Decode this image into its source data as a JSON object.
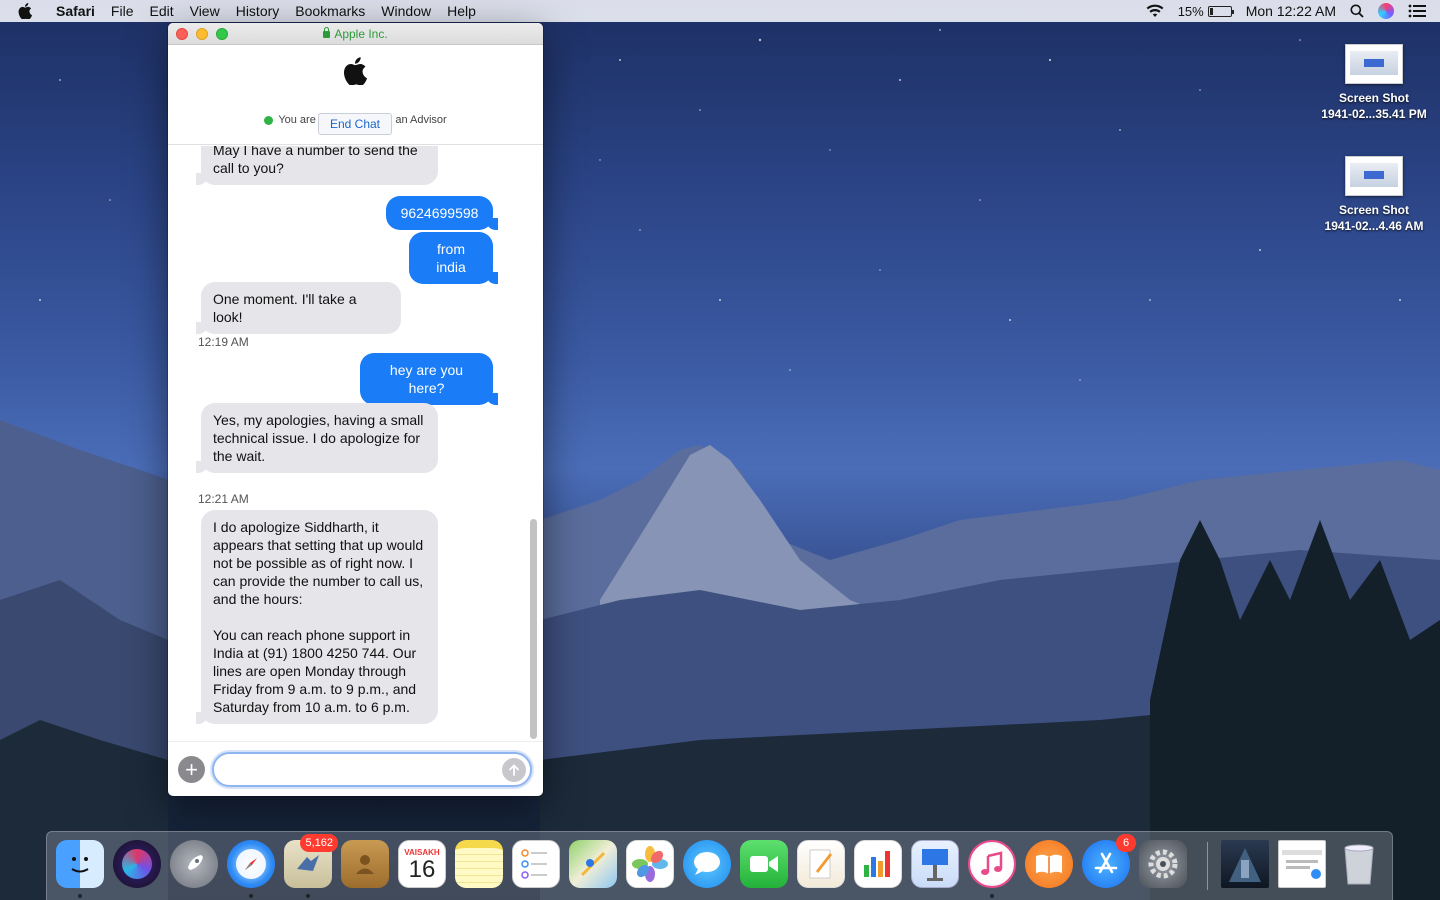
{
  "menubar": {
    "app_name": "Safari",
    "items": [
      "File",
      "Edit",
      "View",
      "History",
      "Bookmarks",
      "Window",
      "Help"
    ],
    "battery_percent": "15%",
    "battery_level": 0.15,
    "clock": "Mon 12:22 AM"
  },
  "desktop_icons": [
    {
      "line1": "Screen Shot",
      "line2": "1941-02...35.41 PM"
    },
    {
      "line1": "Screen Shot",
      "line2": "1941-02...4.46 AM"
    }
  ],
  "window": {
    "title": "Apple Inc.",
    "status_text": "You are connected with an Advisor",
    "end_chat_label": "End Chat",
    "composer_placeholder": ""
  },
  "messages": [
    {
      "dir": "in",
      "text": "May I have a number to send the call to you?"
    },
    {
      "dir": "out",
      "text": "9624699598"
    },
    {
      "dir": "out",
      "text": "from india"
    },
    {
      "dir": "in",
      "text": "One moment. I'll take a look!"
    },
    {
      "dir": "time",
      "text": "12:19 AM"
    },
    {
      "dir": "out",
      "text": "hey are you here?"
    },
    {
      "dir": "in",
      "text": "Yes, my apologies, having a small technical issue. I do apologize for the wait."
    },
    {
      "dir": "time",
      "text": "12:21 AM"
    },
    {
      "dir": "in",
      "text": "I do apologize Siddharth, it appears that setting that up would not be possible as of right now. I can provide the number to call us, and the hours:",
      "text2": "You can reach phone support in India at (91) 1800 4250 744. Our lines are open Monday through Friday from 9 a.m. to 9 p.m., and Saturday from 10 a.m. to 6 p.m."
    }
  ],
  "dock": {
    "mail_badge": "5,162",
    "appstore_badge": "6",
    "calendar_month": "VAISAKH",
    "calendar_day": "16",
    "apps": [
      "finder",
      "siri",
      "launchpad",
      "safari",
      "mail",
      "contacts",
      "calendar",
      "notes",
      "reminders",
      "maps",
      "photos",
      "messages",
      "facetime",
      "pages",
      "numbers",
      "keynote",
      "itunes",
      "ibooks",
      "app-store",
      "system-preferences",
      "movie-thumbnail",
      "safari-window-thumbnail",
      "trash"
    ]
  }
}
